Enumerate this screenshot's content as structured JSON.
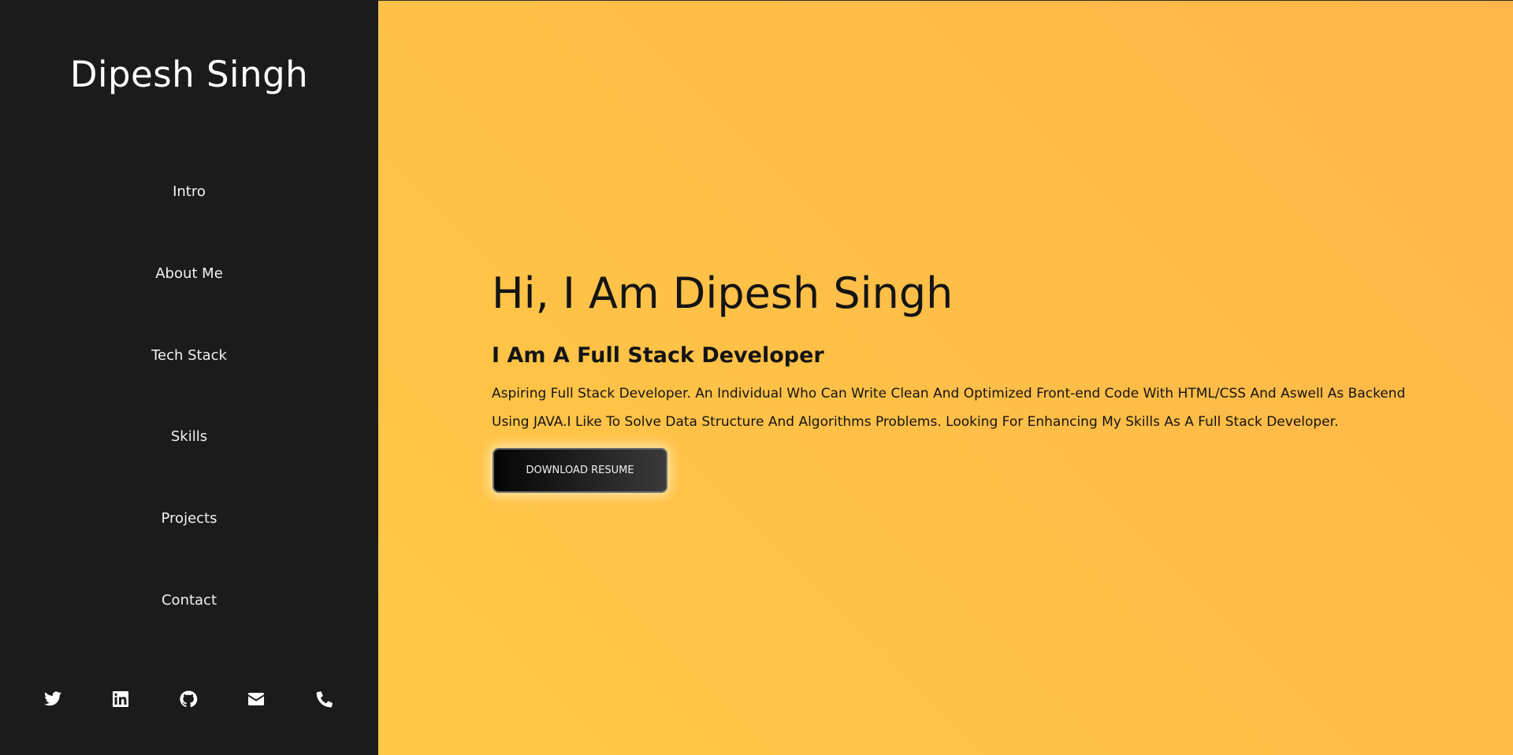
{
  "sidebar": {
    "brand": "Dipesh Singh",
    "nav": [
      {
        "label": "Intro"
      },
      {
        "label": "About Me"
      },
      {
        "label": "Tech Stack"
      },
      {
        "label": "Skills"
      },
      {
        "label": "Projects"
      },
      {
        "label": "Contact"
      }
    ],
    "social": [
      {
        "icon": "twitter-icon"
      },
      {
        "icon": "linkedin-icon"
      },
      {
        "icon": "github-icon"
      },
      {
        "icon": "mail-icon"
      },
      {
        "icon": "phone-icon"
      }
    ]
  },
  "hero": {
    "title": "Hi, I Am Dipesh Singh",
    "subtitle": "I Am A Full Stack Developer",
    "description": "Aspiring Full Stack Developer. An Individual Who Can Write Clean And Optimized Front-end Code With HTML/CSS And Aswell As Backend Using JAVA.I Like To Solve Data Structure And Algorithms Problems. Looking For Enhancing My Skills As A Full Stack Developer.",
    "button_label": "DOWNLOAD RESUME"
  },
  "colors": {
    "sidebar_bg": "#1b1b1b",
    "main_gradient_start": "#ffc947",
    "main_gradient_end": "#ffb548",
    "text_dark": "#141414"
  }
}
